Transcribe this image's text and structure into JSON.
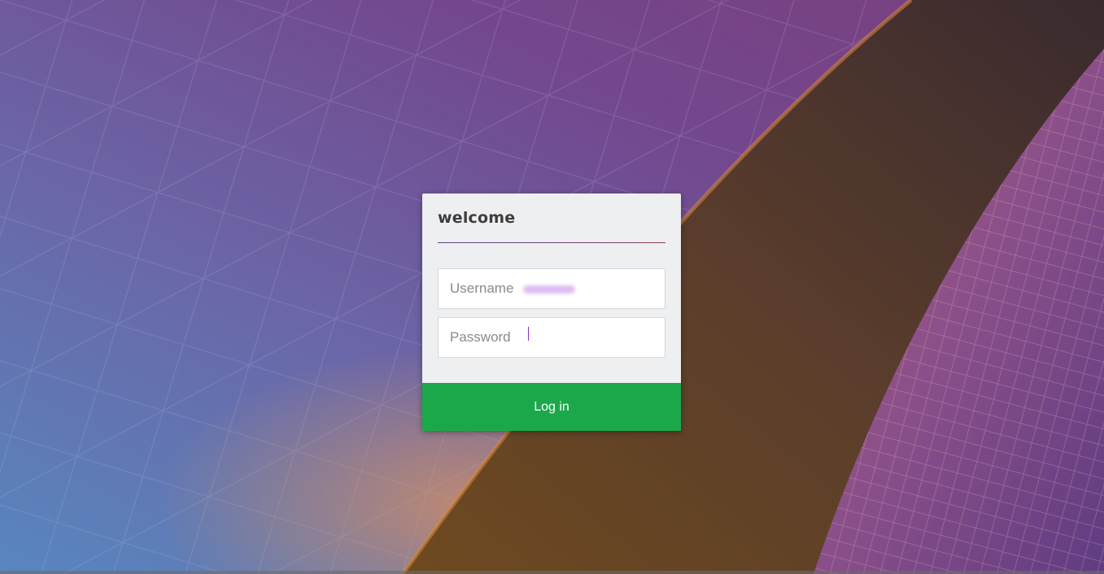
{
  "login": {
    "title": "welcome",
    "username_label": "Username",
    "password_label": "Password",
    "login_label": "Log in"
  },
  "colors": {
    "button": "#1ba84a",
    "card": "#eeeff1",
    "accent_line": "#6d3c78",
    "caret": "#8b2fc2"
  }
}
